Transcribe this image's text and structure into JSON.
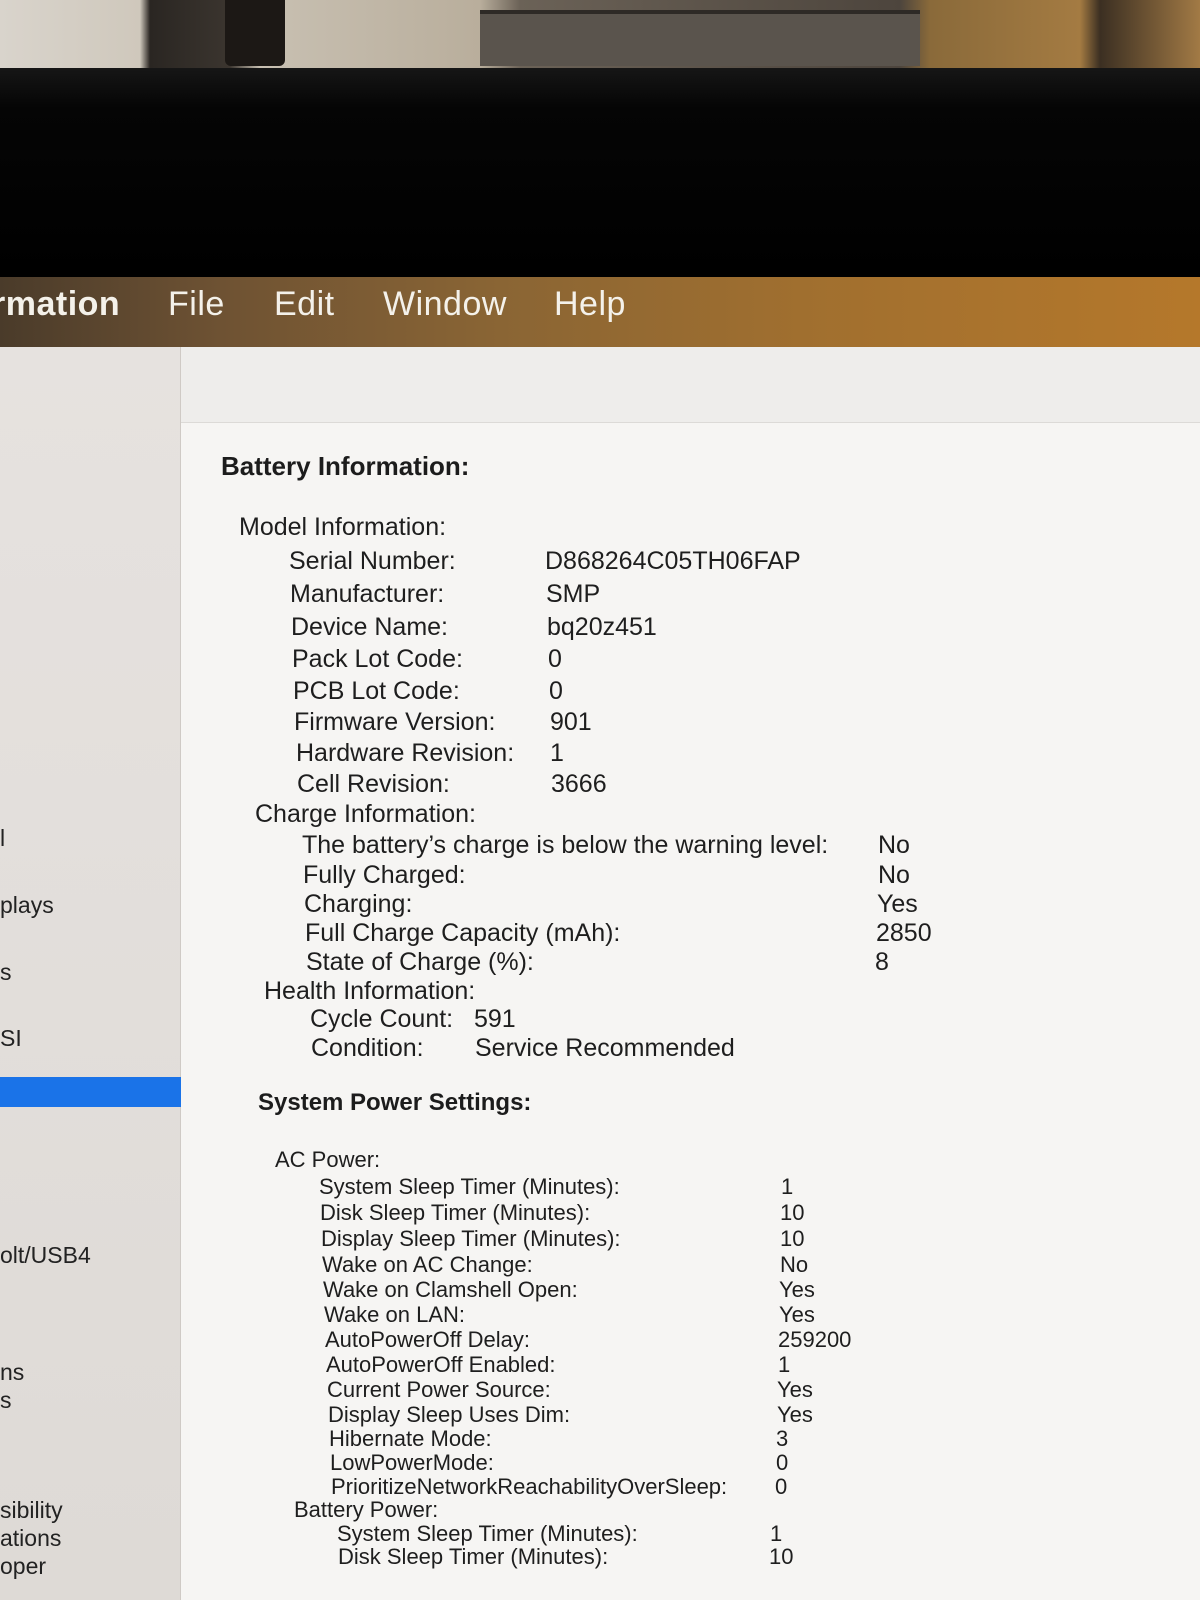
{
  "menubar": {
    "app_name": "rmation",
    "items": [
      "File",
      "Edit",
      "Window",
      "Help"
    ]
  },
  "sidebar": {
    "items": [
      "l",
      "plays",
      "s",
      "SI",
      "olt/USB4",
      "ns",
      "s",
      "sibility",
      "ations",
      "oper"
    ]
  },
  "battery": {
    "title": "Battery Information:",
    "model": {
      "header": "Model Information:",
      "rows": [
        {
          "label": "Serial Number:",
          "value": "D868264C05TH06FAP"
        },
        {
          "label": "Manufacturer:",
          "value": "SMP"
        },
        {
          "label": "Device Name:",
          "value": "bq20z451"
        },
        {
          "label": "Pack Lot Code:",
          "value": "0"
        },
        {
          "label": "PCB Lot Code:",
          "value": "0"
        },
        {
          "label": "Firmware Version:",
          "value": "901"
        },
        {
          "label": "Hardware Revision:",
          "value": "1"
        },
        {
          "label": "Cell Revision:",
          "value": "3666"
        }
      ]
    },
    "charge": {
      "header": "Charge Information:",
      "rows": [
        {
          "label": "The battery’s charge is below the warning level:",
          "value": "No"
        },
        {
          "label": "Fully Charged:",
          "value": "No"
        },
        {
          "label": "Charging:",
          "value": "Yes"
        },
        {
          "label": "Full Charge Capacity (mAh):",
          "value": "2850"
        },
        {
          "label": "State of Charge (%):",
          "value": "8"
        }
      ]
    },
    "health": {
      "header": "Health Information:",
      "rows": [
        {
          "label": "Cycle Count:",
          "value": "591"
        },
        {
          "label": "Condition:",
          "value": "Service Recommended"
        }
      ]
    }
  },
  "power": {
    "title": "System Power Settings:",
    "ac": {
      "header": "AC Power:",
      "rows": [
        {
          "label": "System Sleep Timer (Minutes):",
          "value": "1"
        },
        {
          "label": "Disk Sleep Timer (Minutes):",
          "value": "10"
        },
        {
          "label": "Display Sleep Timer (Minutes):",
          "value": "10"
        },
        {
          "label": "Wake on AC Change:",
          "value": "No"
        },
        {
          "label": "Wake on Clamshell Open:",
          "value": "Yes"
        },
        {
          "label": "Wake on LAN:",
          "value": "Yes"
        },
        {
          "label": "AutoPowerOff Delay:",
          "value": "259200"
        },
        {
          "label": "AutoPowerOff Enabled:",
          "value": "1"
        },
        {
          "label": "Current Power Source:",
          "value": "Yes"
        },
        {
          "label": "Display Sleep Uses Dim:",
          "value": "Yes"
        },
        {
          "label": "Hibernate Mode:",
          "value": "3"
        },
        {
          "label": "LowPowerMode:",
          "value": "0"
        },
        {
          "label": "PrioritizeNetworkReachabilityOverSleep:",
          "value": "0"
        }
      ]
    },
    "battery_power": {
      "header": "Battery Power:",
      "rows": [
        {
          "label": "System Sleep Timer (Minutes):",
          "value": "1"
        },
        {
          "label": "Disk Sleep Timer (Minutes):",
          "value": "10"
        }
      ]
    }
  }
}
